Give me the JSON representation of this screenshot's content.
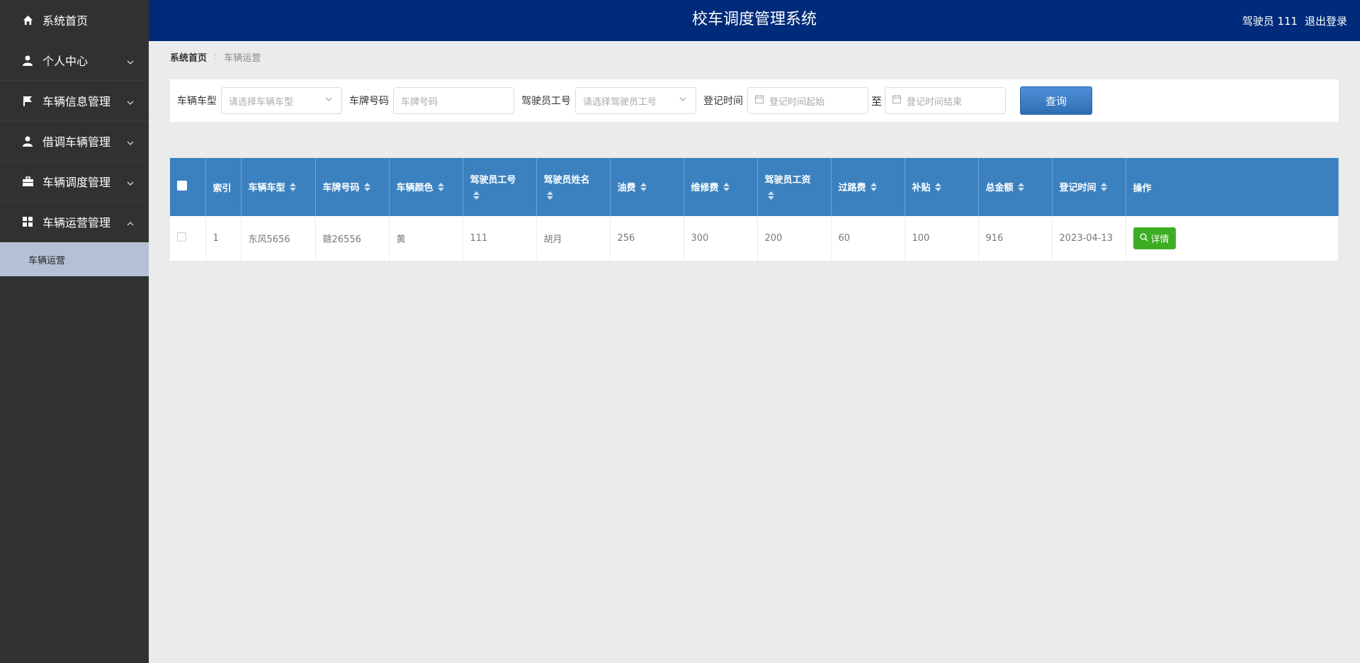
{
  "app": {
    "title": "校车调度管理系统"
  },
  "header": {
    "user": "驾驶员 111",
    "logout": "退出登录"
  },
  "sidebar": {
    "items": [
      {
        "label": "系统首页",
        "icon": "home-icon"
      },
      {
        "label": "个人中心",
        "icon": "user-icon"
      },
      {
        "label": "车辆信息管理",
        "icon": "flag-icon"
      },
      {
        "label": "借调车辆管理",
        "icon": "user-icon"
      },
      {
        "label": "车辆调度管理",
        "icon": "briefcase-icon"
      },
      {
        "label": "车辆运营管理",
        "icon": "grid-icon"
      }
    ],
    "subitem": "车辆运营"
  },
  "breadcrumb": {
    "home": "系统首页",
    "sep": ":",
    "current": "车辆运营"
  },
  "search": {
    "vehicle_type_label": "车辆车型",
    "vehicle_type_placeholder": "请选择车辆车型",
    "plate_label": "车牌号码",
    "plate_placeholder": "车牌号码",
    "driver_id_label": "驾驶员工号",
    "driver_id_placeholder": "请选择驾驶员工号",
    "reg_time_label": "登记时间",
    "start_placeholder": "登记时间起始",
    "to": "至",
    "end_placeholder": "登记时间结束",
    "query_button": "查询"
  },
  "table": {
    "headers": {
      "index": "索引",
      "type": "车辆车型",
      "plate": "车牌号码",
      "color": "车辆颜色",
      "driver_id": "驾驶员工号",
      "driver_name": "驾驶员姓名",
      "fuel": "油费",
      "repair": "维修费",
      "salary": "驾驶员工资",
      "toll": "过路费",
      "subsidy": "补贴",
      "total": "总金额",
      "reg_time": "登记时间",
      "action": "操作"
    },
    "rows": [
      {
        "index": "1",
        "type": "东风5656",
        "plate": "赣26556",
        "color": "黄",
        "driver_id": "111",
        "driver_name": "胡月",
        "fuel": "256",
        "repair": "300",
        "salary": "200",
        "toll": "60",
        "subsidy": "100",
        "total": "916",
        "reg_time": "2023-04-13",
        "action": "详情"
      }
    ]
  },
  "colors": {
    "header": "#002b7a",
    "sidebar": "#313131",
    "table_header": "#3b81c0",
    "detail_button": "#3dad24"
  }
}
